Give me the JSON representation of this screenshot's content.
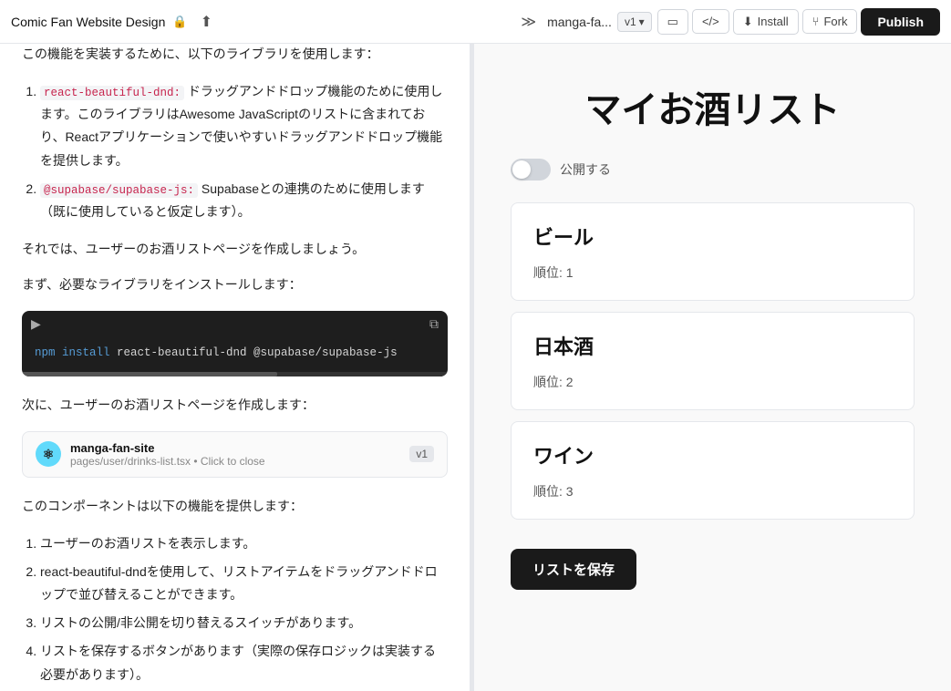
{
  "topbar": {
    "title": "Comic Fan Website Design",
    "lock_icon": "🔒",
    "share_icon": "⬆",
    "collapse_icon": "≫",
    "site_name": "manga-fa...",
    "version": "v1",
    "chevron_icon": "▾",
    "layout_icon": "▭",
    "code_icon": "</>",
    "install_label": "Install",
    "fork_label": "Fork",
    "publish_label": "Publish"
  },
  "left": {
    "intro_text": "この機能を実装するために、以下のライブラリを使用します：",
    "list1": [
      {
        "label": "react-beautiful-dnd: ドラッグアンドドロップ機能のために使用します。このライブラリはAwesome JavaScriptのリストに含まれており、Reactアプリケーションで使いやすいドラッグアンドドロップ機能を提供します。"
      },
      {
        "label": "@supabase/supabase-js: Supabaseとの連携のために使用します（既に使用していると仮定します）。"
      }
    ],
    "para1": "それでは、ユーザーのお酒リストページを作成しましょう。",
    "para2": "まず、必要なライブラリをインストールします：",
    "code_keyword": "npm install",
    "code_rest": " react-beautiful-dnd @supabase/supabase-js",
    "para3": "次に、ユーザーのお酒リストページを作成します：",
    "file_name": "manga-fan-site",
    "file_path": "pages/user/drinks-list.tsx • Click to close",
    "file_version": "v1",
    "para4": "このコンポーネントは以下の機能を提供します：",
    "list2": [
      {
        "label": "ユーザーのお酒リストを表示します。"
      },
      {
        "label": "react-beautiful-dndを使用して、リストアイテムをドラッグアンドドロップで並び替えることができます。"
      },
      {
        "label": "リストの公開/非公開を切り替えるスイッチがあります。"
      },
      {
        "label": "リストを保存するボタンがあります（実際の保存ロジックは実装する必要があります）。"
      }
    ]
  },
  "right": {
    "title": "マイお酒リスト",
    "toggle_active": false,
    "toggle_label": "公開する",
    "drinks": [
      {
        "name": "ビール",
        "rank_label": "順位: 1"
      },
      {
        "name": "日本酒",
        "rank_label": "順位: 2"
      },
      {
        "name": "ワイン",
        "rank_label": "順位: 3"
      }
    ],
    "save_button_label": "リストを保存"
  }
}
